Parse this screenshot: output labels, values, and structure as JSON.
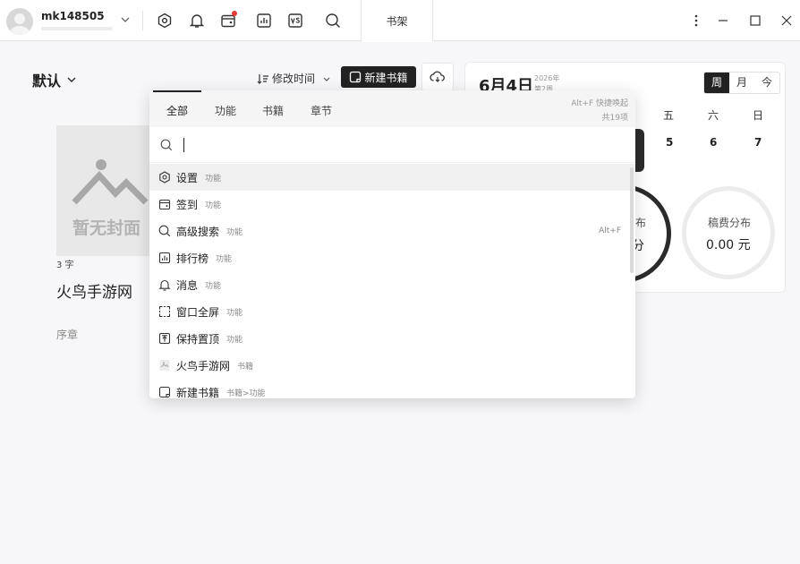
{
  "user": {
    "name": "mk148505"
  },
  "toolbar_icons": [
    "settings-icon",
    "bell-icon",
    "checkin-icon",
    "ranking-icon",
    "vs-icon",
    "search-icon"
  ],
  "active_tab": "书架",
  "shelf": {
    "filter_label": "默认",
    "sort_label": "修改时间",
    "new_book_label": "新建书籍",
    "book": {
      "cover_placeholder": "暂无封面",
      "word_count": "3 字",
      "title": "火鸟手游网",
      "chapter": "序章"
    }
  },
  "calendar": {
    "date": "6月4日",
    "year": "2026年",
    "week": "第2周",
    "views": [
      "周",
      "月",
      "今"
    ],
    "active_view": "周",
    "weekdays": [
      "五",
      "六",
      "日"
    ],
    "day_numbers": [
      "5",
      "6",
      "7"
    ],
    "stat_left_label": "布",
    "stat_left_value": "分",
    "stat_right_label": "稿费分布",
    "stat_right_value": "0.00 元"
  },
  "palette": {
    "tabs": [
      "全部",
      "功能",
      "书籍",
      "章节"
    ],
    "active_tab": "全部",
    "hint_line1": "Alt+F 快捷唤起",
    "hint_line2": "共19项",
    "search_value": "",
    "items": [
      {
        "icon": "settings-icon",
        "label": "设置",
        "tag": "功能",
        "shortcut": ""
      },
      {
        "icon": "checkin-icon",
        "label": "签到",
        "tag": "功能",
        "shortcut": ""
      },
      {
        "icon": "search-icon",
        "label": "高级搜索",
        "tag": "功能",
        "shortcut": "Alt+F"
      },
      {
        "icon": "ranking-icon",
        "label": "排行榜",
        "tag": "功能",
        "shortcut": ""
      },
      {
        "icon": "bell-icon",
        "label": "消息",
        "tag": "功能",
        "shortcut": ""
      },
      {
        "icon": "fullscreen-icon",
        "label": "窗口全屏",
        "tag": "功能",
        "shortcut": ""
      },
      {
        "icon": "pin-top-icon",
        "label": "保持置顶",
        "tag": "功能",
        "shortcut": ""
      },
      {
        "icon": "book-cover-icon",
        "label": "火鸟手游网",
        "tag": "书籍",
        "shortcut": ""
      },
      {
        "icon": "new-book-icon",
        "label": "新建书籍",
        "tag": "书籍>功能",
        "shortcut": ""
      }
    ]
  }
}
